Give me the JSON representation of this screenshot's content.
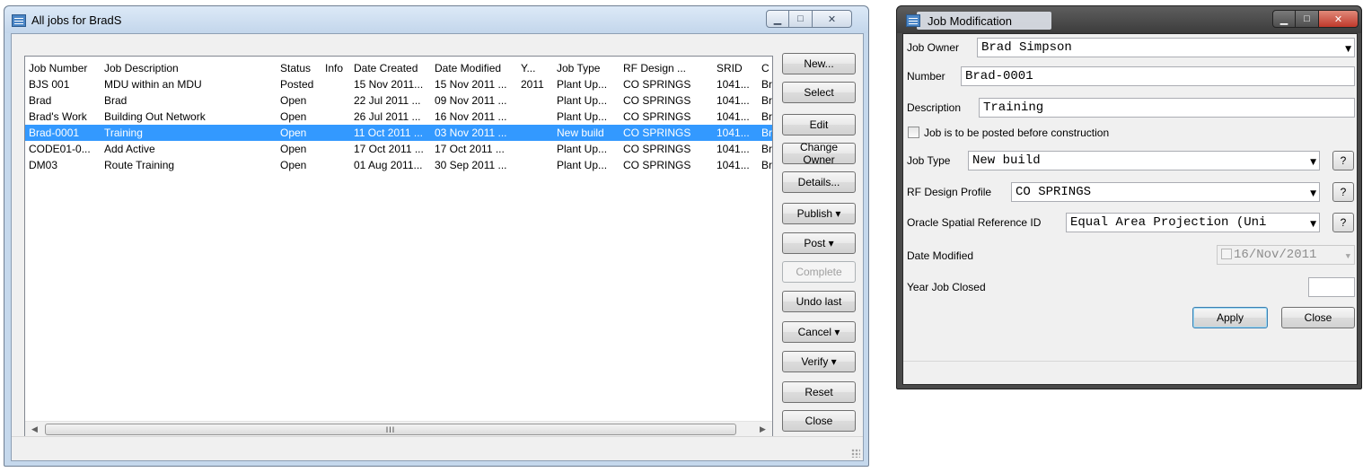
{
  "jobs_window": {
    "title": "All jobs for BradS",
    "columns": [
      "Job Number",
      "Job Description",
      "Status",
      "Info",
      "Date Created",
      "Date Modified",
      "Y...",
      "Job Type",
      "RF Design ...",
      "SRID",
      "C"
    ],
    "rows": [
      {
        "job_number": "BJS 001",
        "description": "MDU within an MDU",
        "status": "Posted",
        "info": "",
        "created": "15 Nov 2011...",
        "modified": "15 Nov 2011 ...",
        "year": "2011",
        "job_type": "Plant Up...",
        "rf_design": "CO SPRINGS",
        "srid": "1041...",
        "c": "Br"
      },
      {
        "job_number": "Brad",
        "description": "Brad",
        "status": "Open",
        "info": "",
        "created": "22 Jul 2011 ...",
        "modified": "09 Nov 2011 ...",
        "year": "",
        "job_type": "Plant Up...",
        "rf_design": "CO SPRINGS",
        "srid": "1041...",
        "c": "Br"
      },
      {
        "job_number": "Brad's Work",
        "description": "Building Out Network",
        "status": "Open",
        "info": "",
        "created": "26 Jul 2011 ...",
        "modified": "16 Nov 2011 ...",
        "year": "",
        "job_type": "Plant Up...",
        "rf_design": "CO SPRINGS",
        "srid": "1041...",
        "c": "Br"
      },
      {
        "job_number": "Brad-0001",
        "description": "Training",
        "status": "Open",
        "info": "",
        "created": "11 Oct 2011 ...",
        "modified": "03 Nov 2011 ...",
        "year": "",
        "job_type": "New build",
        "rf_design": "CO SPRINGS",
        "srid": "1041...",
        "c": "Br",
        "selected": true
      },
      {
        "job_number": "CODE01-0...",
        "description": "Add Active",
        "status": "Open",
        "info": "",
        "created": "17 Oct 2011 ...",
        "modified": "17 Oct 2011 ...",
        "year": "",
        "job_type": "Plant Up...",
        "rf_design": "CO SPRINGS",
        "srid": "1041...",
        "c": "Br"
      },
      {
        "job_number": "DM03",
        "description": "Route Training",
        "status": "Open",
        "info": "",
        "created": "01 Aug 2011...",
        "modified": "30 Sep 2011 ...",
        "year": "",
        "job_type": "Plant Up...",
        "rf_design": "CO SPRINGS",
        "srid": "1041...",
        "c": "Br"
      }
    ],
    "buttons": {
      "new": "New...",
      "select": "Select",
      "edit": "Edit",
      "change_owner": "Change Owner",
      "details": "Details...",
      "publish": "Publish ▾",
      "post": "Post ▾",
      "complete": "Complete",
      "undo_last": "Undo last",
      "cancel": "Cancel ▾",
      "verify": "Verify ▾",
      "reset": "Reset",
      "close": "Close"
    },
    "scroll_grip": "III"
  },
  "mod_window": {
    "title": "Job Modification",
    "job_owner_label": "Job Owner",
    "job_owner_value": "Brad Simpson",
    "number_label": "Number",
    "number_value": "Brad-0001",
    "description_label": "Description",
    "description_value": "Training",
    "posted_checkbox_label": "Job is to be posted before construction",
    "job_type_label": "Job Type",
    "job_type_value": "New build",
    "rf_profile_label": "RF Design Profile",
    "rf_profile_value": "CO SPRINGS",
    "srid_label": "Oracle Spatial Reference ID",
    "srid_value": "Equal Area Projection (Uni",
    "date_modified_label": "Date Modified",
    "date_modified_value": "16/Nov/2011",
    "year_closed_label": "Year Job Closed",
    "year_closed_value": "",
    "help_label": "?",
    "apply_label": "Apply",
    "close_label": "Close"
  },
  "colors": {
    "selection": "#3399ff",
    "frame_light": "#c5d8ec",
    "frame_dark": "#4a4a4a"
  }
}
